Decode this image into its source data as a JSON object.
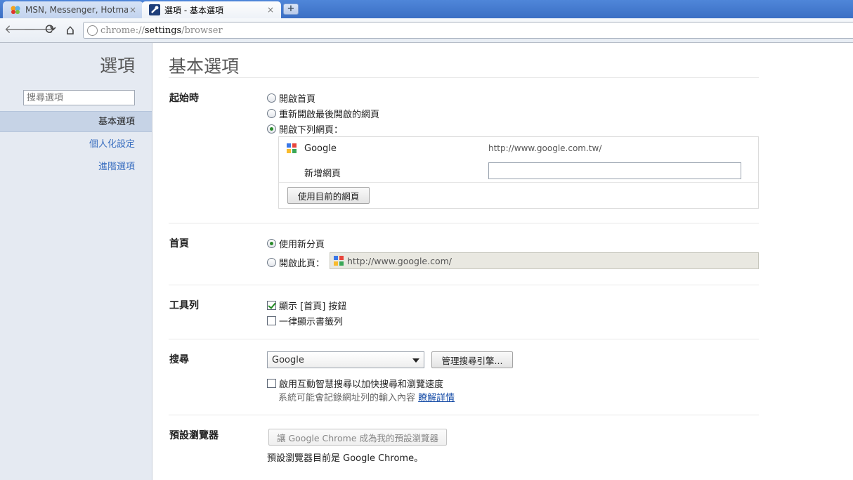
{
  "tabs": [
    {
      "title": "MSN, Messenger, Hotmail - MSN",
      "close": "×"
    },
    {
      "title": "選項 - 基本選項",
      "close": "×"
    }
  ],
  "newtab_label": "+",
  "toolbar": {
    "url_scheme": "chrome://",
    "url_host": "settings",
    "url_path": "/browser",
    "back_glyph": "🡐",
    "forward_glyph": "🡒",
    "reload_glyph": "⟳",
    "home_glyph": "⌂"
  },
  "sidebar": {
    "title": "選項",
    "search_placeholder": "搜尋選項",
    "items": [
      {
        "label": "基本選項",
        "selected": true
      },
      {
        "label": "個人化設定",
        "selected": false
      },
      {
        "label": "進階選項",
        "selected": false
      }
    ]
  },
  "main": {
    "title": "基本選項",
    "startup": {
      "title": "起始時",
      "options": [
        "開啟首頁",
        "重新開啟最後開啟的網頁",
        "開啟下列網頁："
      ],
      "selected_index": 2,
      "pages": [
        {
          "name": "Google",
          "url": "http://www.google.com.tw/"
        }
      ],
      "new_page_label": "新增網頁",
      "use_current_button": "使用目前的網頁"
    },
    "homepage": {
      "title": "首頁",
      "option_newtab": "使用新分頁",
      "option_open": "開啟此頁：",
      "url": "http://www.google.com/"
    },
    "toolbar_section": {
      "title": "工具列",
      "show_home": "顯示 [首頁] 按鈕",
      "show_home_checked": true,
      "always_bookmarks": "一律顯示書籤列",
      "always_bookmarks_checked": false
    },
    "search": {
      "title": "搜尋",
      "engine": "Google",
      "manage_button": "管理搜尋引擎...",
      "instant_label": "啟用互動智慧搜尋以加快搜尋和瀏覽速度",
      "instant_checked": false,
      "note": "系統可能會記錄網址列的輸入內容",
      "learn_more": "瞭解詳情"
    },
    "default_browser": {
      "title": "預設瀏覽器",
      "button": "讓 Google Chrome 成為我的預設瀏覽器",
      "status": "預設瀏覽器目前是 Google Chrome。"
    }
  },
  "colors": {
    "tabstrip": "#3b6fc4",
    "sidebar_bg": "#e5eaf2",
    "sidebar_selected": "#c6d3e6",
    "link": "#3a6fc0",
    "radio_dot": "#2a8a2a"
  }
}
